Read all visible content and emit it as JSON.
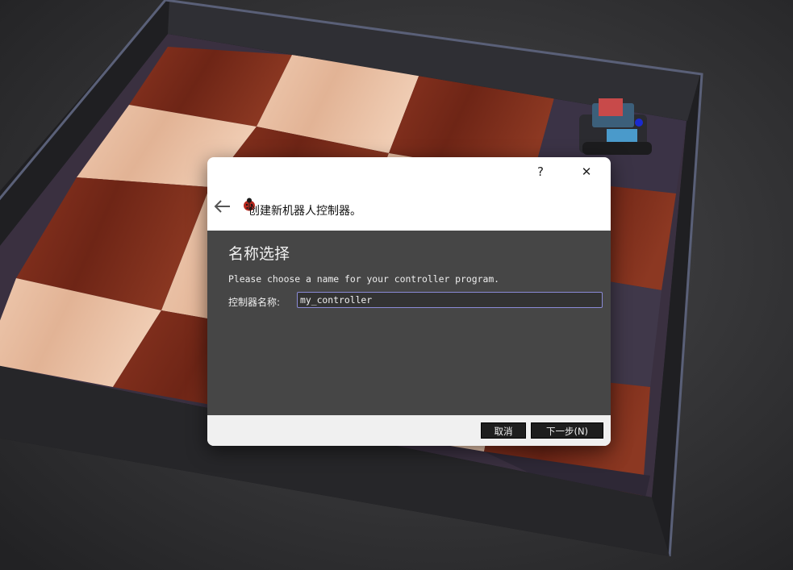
{
  "dialog": {
    "help_label": "?",
    "close_label": "✕",
    "wizard_title": "创建新机器人控制器。",
    "page_title": "名称选择",
    "description": "Please choose a name for your controller program.",
    "name_label": "控制器名称:",
    "name_value": "my_controller",
    "cancel_label": "取消",
    "next_label": "下一步(N)"
  },
  "colors": {
    "content_bg": "#464646",
    "input_border": "#8a8ad6",
    "button_bg": "#1e1e1e",
    "wood_light": "#e9bfa3",
    "wood_dark": "#7a2d1c",
    "arena_wall": "#2f2f34"
  },
  "icons": {
    "back": "arrow-left-icon",
    "wizard": "ladybug-icon",
    "close": "close-icon"
  }
}
